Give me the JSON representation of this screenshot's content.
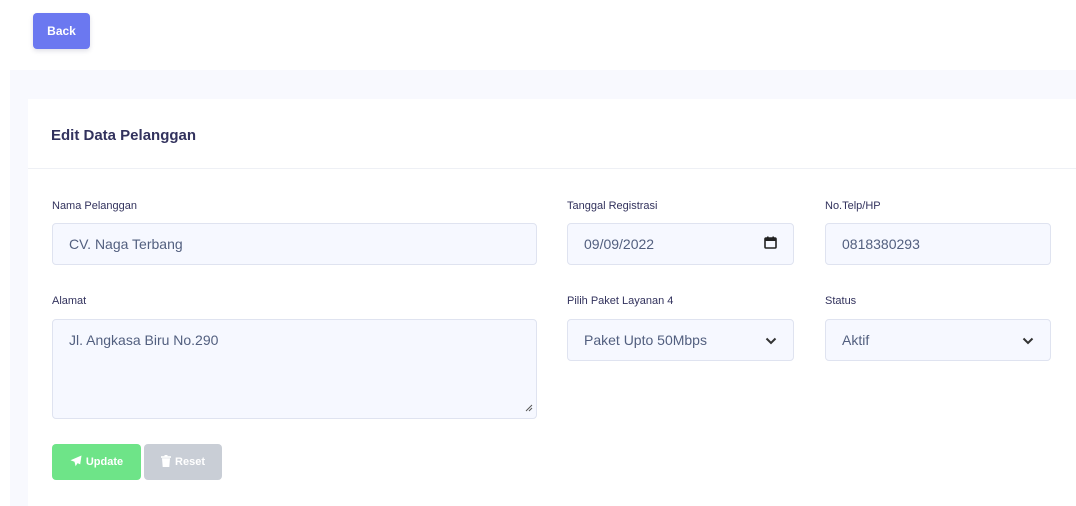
{
  "header": {
    "back_label": "Back"
  },
  "card": {
    "title": "Edit Data Pelanggan",
    "form": {
      "nama": {
        "label": "Nama Pelanggan",
        "value": "CV. Naga Terbang"
      },
      "tanggal": {
        "label": "Tanggal Registrasi",
        "value": "09/09/2022"
      },
      "telp": {
        "label": "No.Telp/HP",
        "value": "0818380293"
      },
      "alamat": {
        "label": "Alamat",
        "value": "Jl. Angkasa Biru No.290"
      },
      "paket": {
        "label": "Pilih Paket Layanan 4",
        "value": "Paket Upto 50Mbps"
      },
      "status": {
        "label": "Status",
        "value": "Aktif"
      }
    },
    "actions": {
      "update_label": "Update",
      "reset_label": "Reset"
    }
  },
  "icons": {
    "calendar": "calendar-icon",
    "chevron": "chevron-down-icon",
    "update": "paper-plane-icon",
    "reset": "trash-icon"
  },
  "colors": {
    "primary": "#6b78f0",
    "success": "#6ee488",
    "secondary": "#c9ced6",
    "field_bg": "#f6f8ff"
  }
}
